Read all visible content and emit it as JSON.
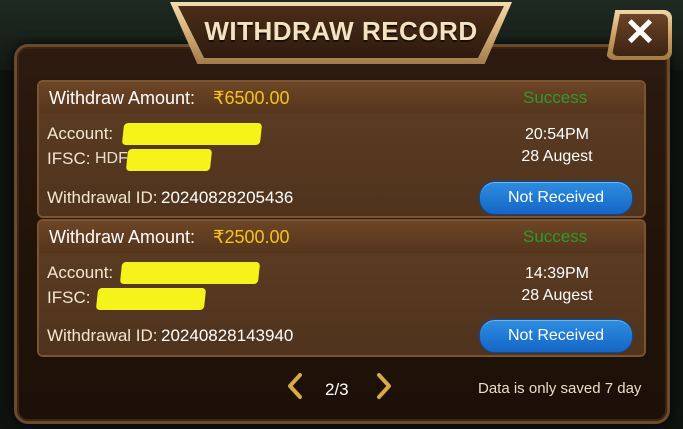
{
  "dialog": {
    "title": "WITHDRAW RECORD",
    "close_label": "✕"
  },
  "records": [
    {
      "amount_label": "Withdraw Amount:",
      "amount": "₹6500.00",
      "status": "Success",
      "account_label": "Account:",
      "ifsc_label": "IFSC:",
      "ifsc_partial": "HDF",
      "time": "20:54PM",
      "date": "28 Augest",
      "withdrawal_id_label": "Withdrawal ID:",
      "withdrawal_id": "20240828205436",
      "action_label": "Not Received"
    },
    {
      "amount_label": "Withdraw Amount:",
      "amount": "₹2500.00",
      "status": "Success",
      "account_label": "Account:",
      "ifsc_label": "IFSC:",
      "time": "14:39PM",
      "date": "28 Augest",
      "withdrawal_id_label": "Withdrawal ID:",
      "withdrawal_id": "20240828143940",
      "action_label": "Not Received"
    }
  ],
  "pagination": {
    "page_text": "2/3",
    "prev_icon": "chevron-left-icon",
    "next_icon": "chevron-right-icon"
  },
  "footer": {
    "note": "Data is only saved 7 day"
  },
  "colors": {
    "amount": "#f5c518",
    "status_success": "#2f9a2a",
    "button_blue": "#1f7ad6",
    "mask_yellow": "#f6f31b",
    "accent_gold": "#d8b27a"
  }
}
